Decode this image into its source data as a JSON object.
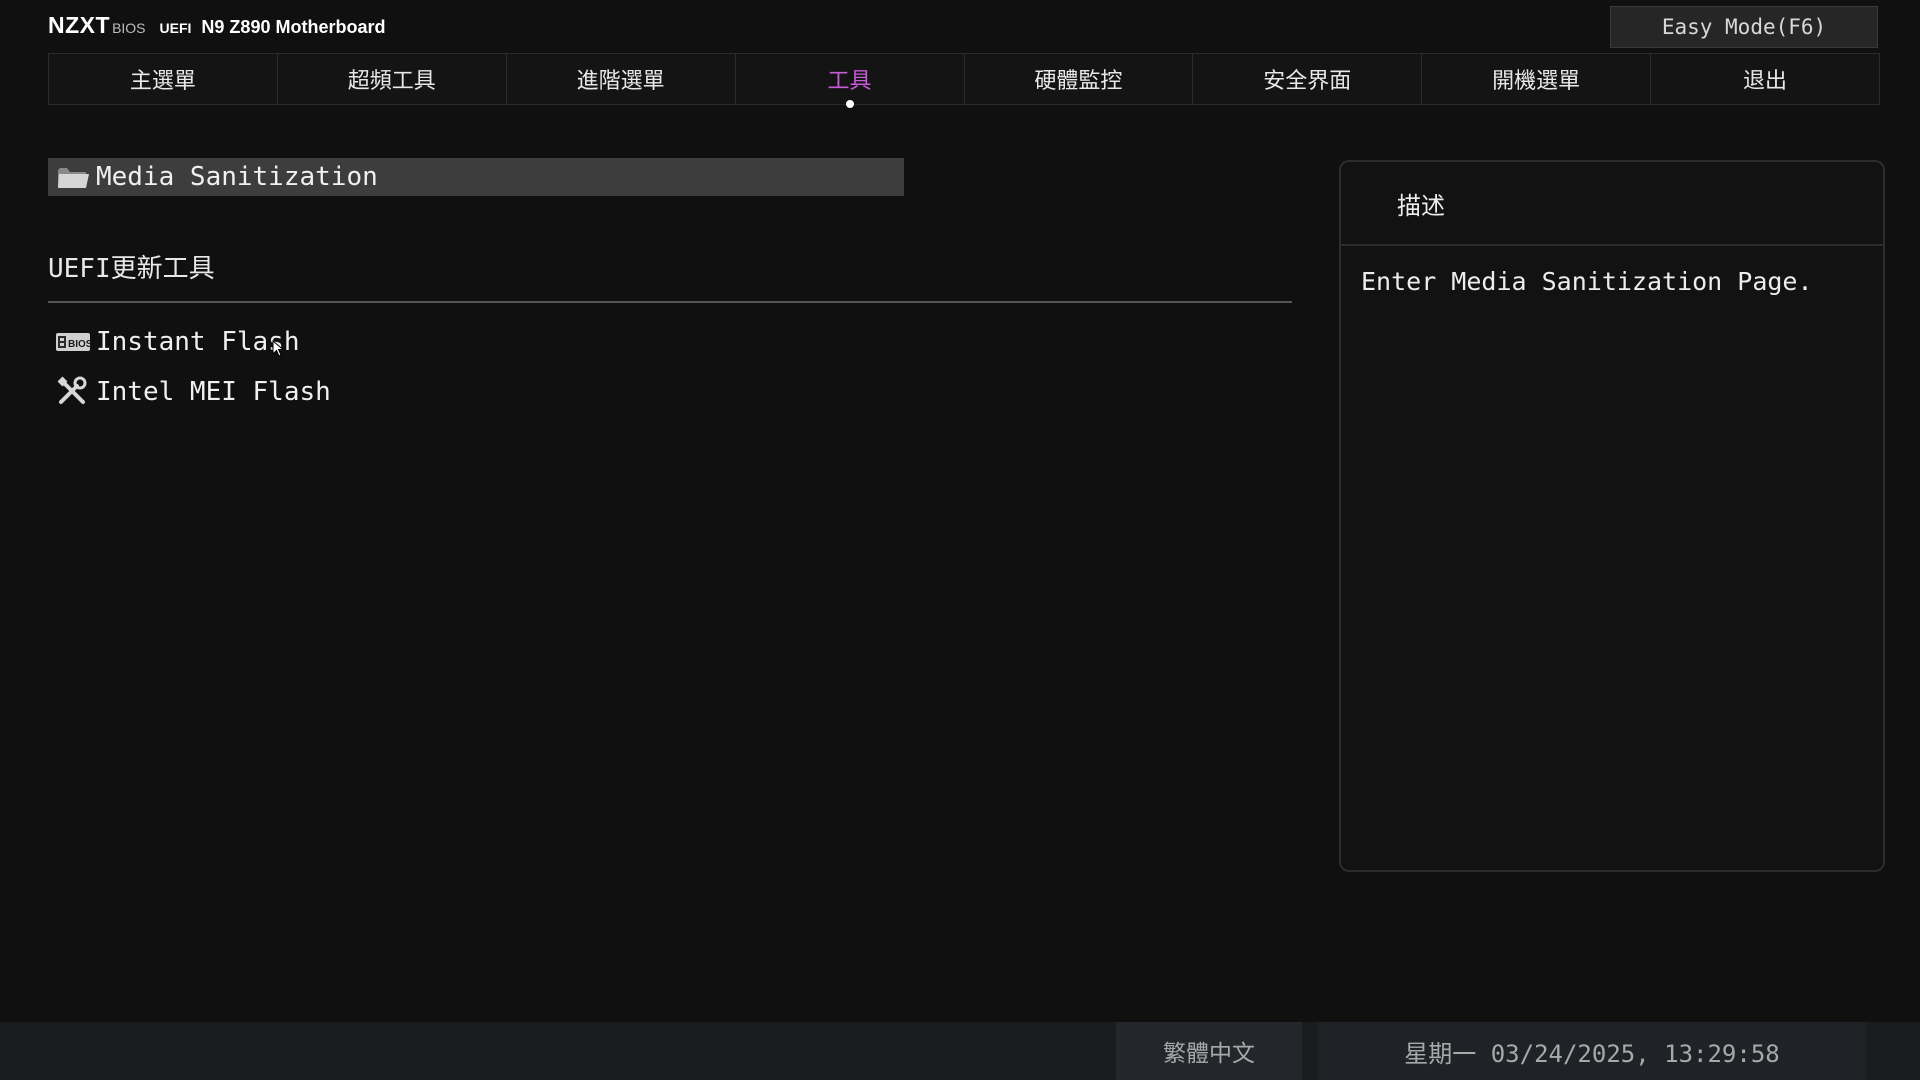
{
  "brand": {
    "logo": "NZXT",
    "bios": "BIOS",
    "uefi": "UEFI",
    "model": "N9 Z890 Motherboard"
  },
  "easy_mode_label": "Easy Mode(F6)",
  "tabs": [
    {
      "label": "主選單",
      "active": false
    },
    {
      "label": "超頻工具",
      "active": false
    },
    {
      "label": "進階選單",
      "active": false
    },
    {
      "label": "工具",
      "active": true
    },
    {
      "label": "硬體監控",
      "active": false
    },
    {
      "label": "安全界面",
      "active": false
    },
    {
      "label": "開機選單",
      "active": false
    },
    {
      "label": "退出",
      "active": false
    }
  ],
  "main": {
    "selected_item": {
      "label": "Media Sanitization",
      "icon": "folder-icon"
    },
    "section_title": "UEFI更新工具",
    "items": [
      {
        "label": "Instant Flash",
        "icon": "bios-chip-icon"
      },
      {
        "label": "Intel MEI Flash",
        "icon": "tools-icon"
      }
    ]
  },
  "description": {
    "title": "描述",
    "text": "Enter Media Sanitization Page."
  },
  "footer": {
    "language": "繁體中文",
    "datetime": "星期一 03/24/2025, 13:29:58"
  },
  "colors": {
    "background": "#101010",
    "active_tab": "#c85bd8",
    "selected_row": "#3d3d3d"
  }
}
